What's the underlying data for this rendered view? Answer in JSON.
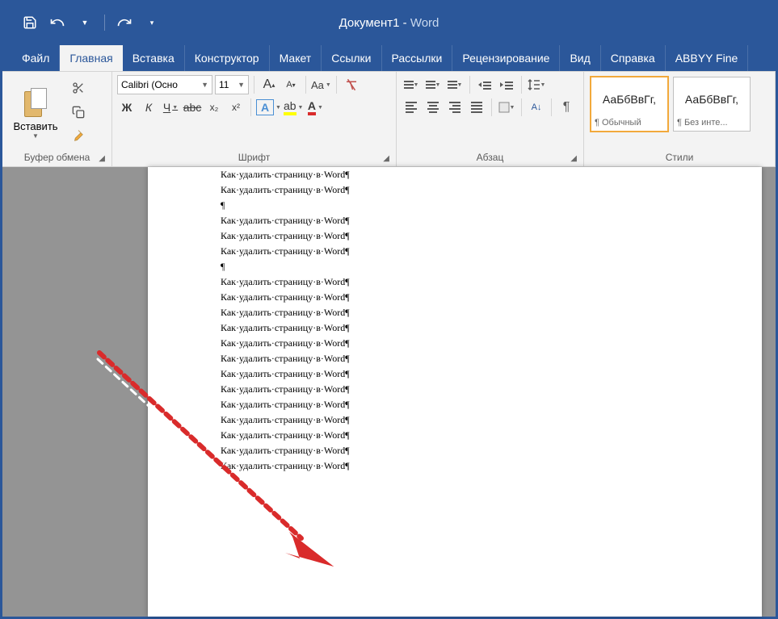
{
  "title": {
    "doc": "Документ1",
    "sep": "  -  ",
    "app": "Word"
  },
  "tabs": [
    "Файл",
    "Главная",
    "Вставка",
    "Конструктор",
    "Макет",
    "Ссылки",
    "Рассылки",
    "Рецензирование",
    "Вид",
    "Справка",
    "ABBYY Fine"
  ],
  "active_tab": 1,
  "clipboard": {
    "paste": "Вставить",
    "label": "Буфер обмена"
  },
  "font": {
    "name": "Calibri (Осно",
    "size": "11",
    "bold": "Ж",
    "italic": "К",
    "under": "Ч",
    "strike": "abc",
    "sub": "x₂",
    "sup": "x²",
    "effect": "A",
    "hilite": "ab",
    "color": "A",
    "clear": "Aa",
    "grow": "A",
    "shrink": "A",
    "label": "Шрифт"
  },
  "para": {
    "pilcrow": "¶",
    "sort": "A↓",
    "label": "Абзац"
  },
  "styles": {
    "preview": "АаБбВвГг,",
    "s1": "¶ Обычный",
    "s2": "¶ Без инте...",
    "label": "Стили"
  },
  "document": {
    "line": "Как·удалить·страницу·в·Word¶",
    "blank": "¶"
  }
}
